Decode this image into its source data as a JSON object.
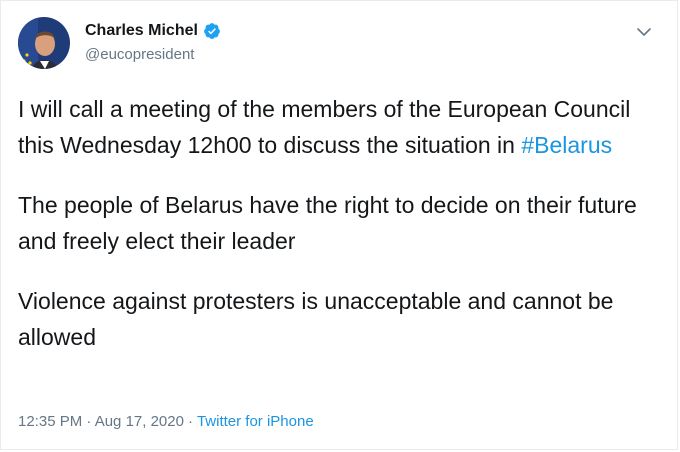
{
  "tweet": {
    "author": {
      "display_name": "Charles Michel",
      "handle": "@eucopresident",
      "verified": true,
      "avatar_icon": "avatar-photo",
      "verified_icon": "verified-badge-icon"
    },
    "menu_icon": "chevron-down-icon",
    "paragraphs": {
      "p1_before": "I will call a meeting of the members of the European Council this Wednesday 12h00 to discuss the situation in ",
      "p1_hashtag": "#Belarus",
      "p2": "The people of Belarus have the right to decide on their future and freely elect their leader",
      "p3": "Violence against protesters is unacceptable and cannot be allowed"
    },
    "timestamp": "12:35 PM · Aug 17, 2020",
    "separator": "·",
    "source": "Twitter for iPhone"
  },
  "colors": {
    "link": "#1b95e0",
    "text": "#14171a",
    "muted": "#657786",
    "verified": "#1da1f2"
  }
}
